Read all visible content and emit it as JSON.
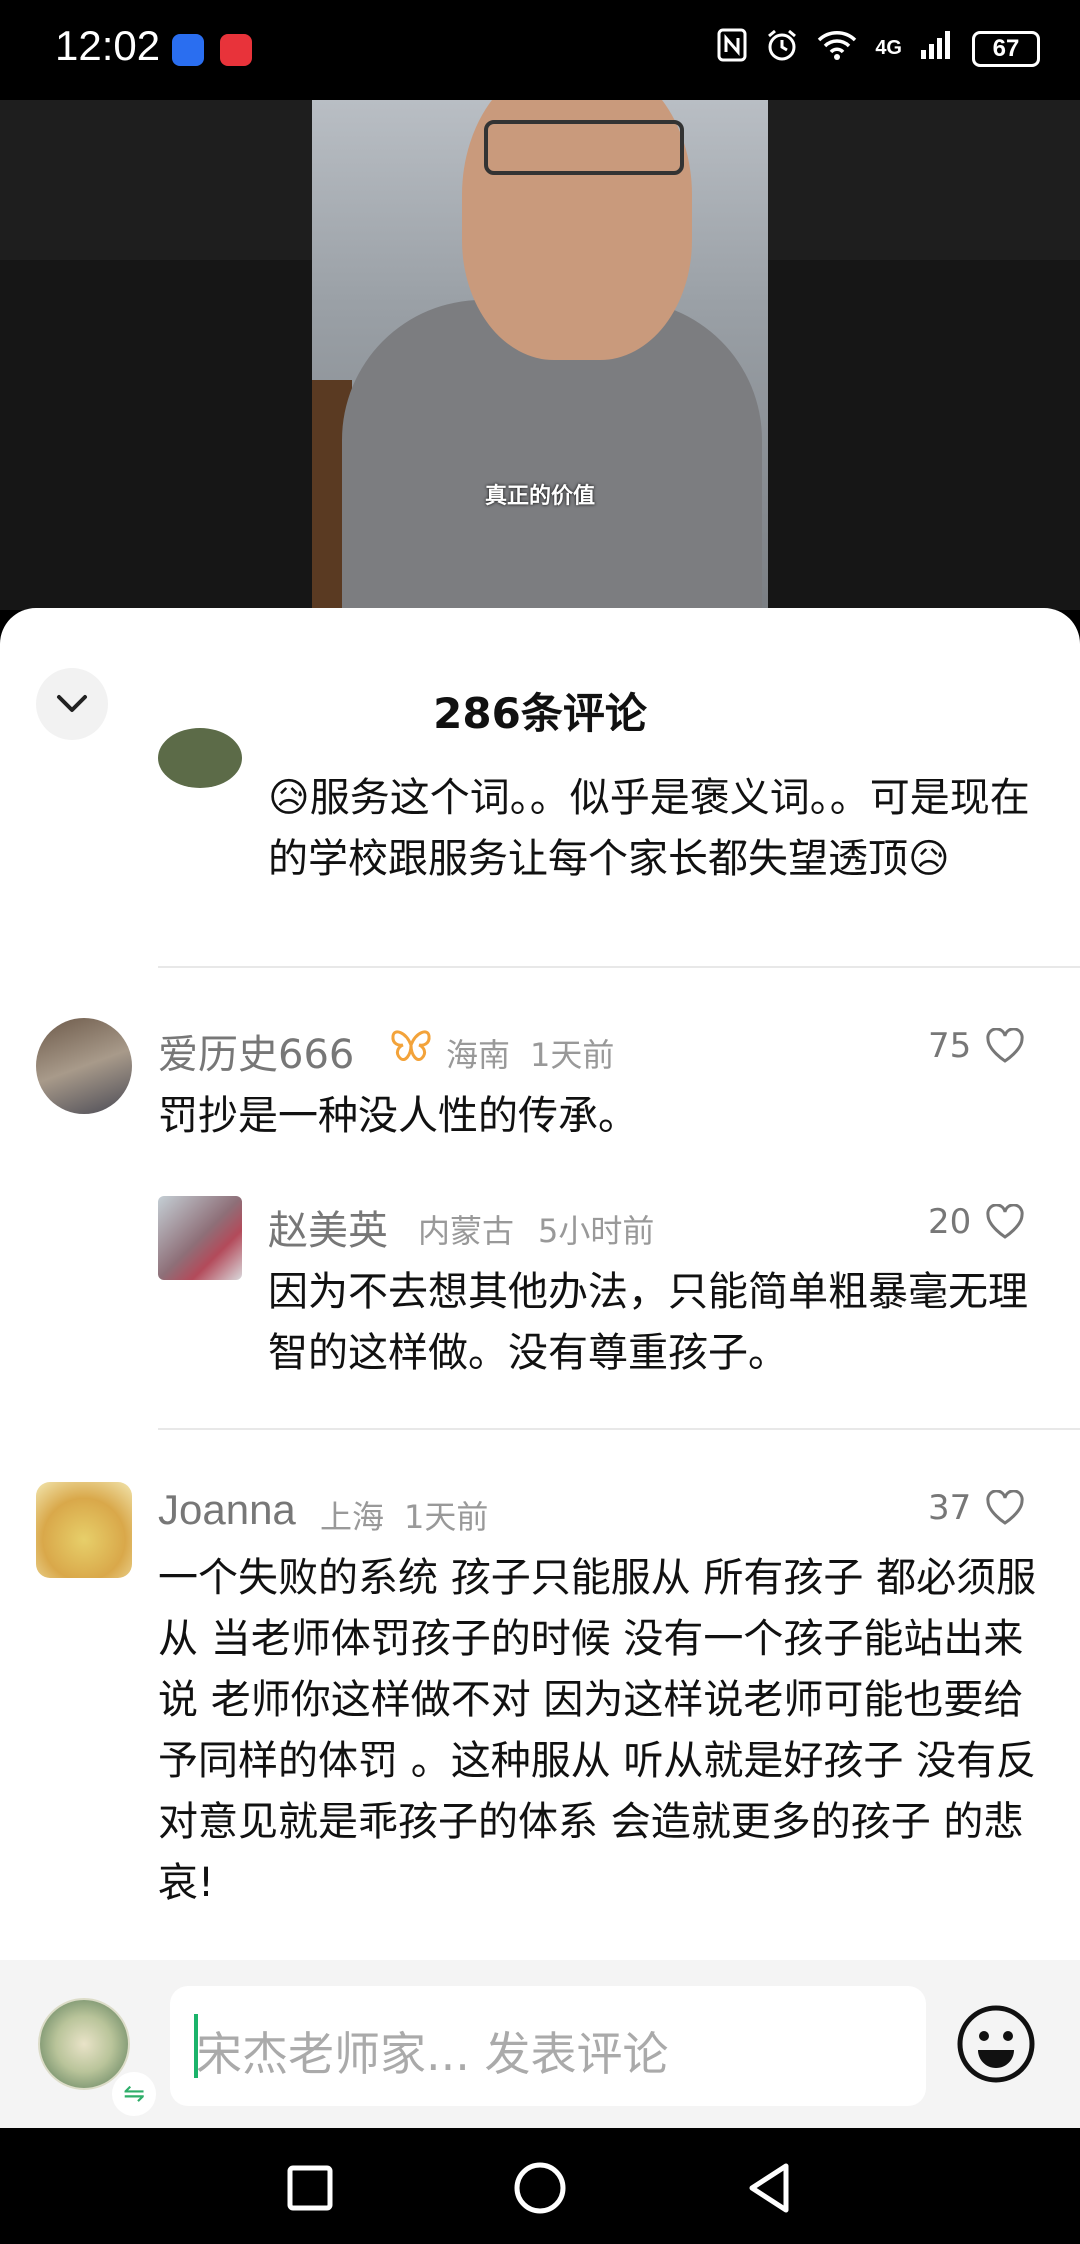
{
  "status_bar": {
    "time": "12:02",
    "network": "4G",
    "battery": "67"
  },
  "video": {
    "caption": "真正的价值"
  },
  "comments_sheet": {
    "title": "286条评论",
    "comments": [
      {
        "text": "😥服务这个词。。似乎是褒义词。。可是现在的学校跟服务让每个家长都失望透顶😥"
      },
      {
        "user": "爱历史666",
        "badge_icon": "butterfly-icon",
        "location": "海南",
        "time": "1天前",
        "likes": "75",
        "text": "罚抄是一种没人性的传承。"
      },
      {
        "user": "赵美英",
        "location": "内蒙古",
        "time": "5小时前",
        "likes": "20",
        "text": "因为不去想其他办法，只能简单粗暴毫无理智的这样做。没有尊重孩子。"
      },
      {
        "user": "Joanna",
        "location": "上海",
        "time": "1天前",
        "likes": "37",
        "text": "一个失败的系统 孩子只能服从 所有孩子 都必须服从  当老师体罚孩子的时候 没有一个孩子能站出来 说 老师你这样做不对 因为这样说老师可能也要给予同样的体罚 。这种服从 听从就是好孩子 没有反对意见就是乖孩子的体系 会造就更多的孩子 的悲哀!"
      }
    ]
  },
  "input_bar": {
    "placeholder": "宋杰老师家... 发表评论"
  },
  "colors": {
    "accent_green": "#1bb36a",
    "badge_orange": "#f3a33a"
  }
}
